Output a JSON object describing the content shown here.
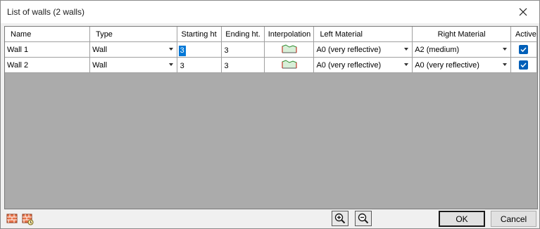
{
  "window": {
    "title": "List of walls (2 walls)"
  },
  "columns": [
    {
      "key": "name",
      "label": "Name"
    },
    {
      "key": "type",
      "label": "Type"
    },
    {
      "key": "start",
      "label": "Starting ht"
    },
    {
      "key": "end",
      "label": "Ending ht."
    },
    {
      "key": "interp",
      "label": "Interpolation"
    },
    {
      "key": "left",
      "label": "Left Material"
    },
    {
      "key": "right",
      "label": "Right Material"
    },
    {
      "key": "active",
      "label": "Active"
    }
  ],
  "rows": [
    {
      "name": "Wall 1",
      "type": "Wall",
      "start": "3",
      "end": "3",
      "left": "A0 (very reflective)",
      "right": "A2 (medium)",
      "active": true
    },
    {
      "name": "Wall 2",
      "type": "Wall",
      "start": "3",
      "end": "3",
      "left": "A0 (very reflective)",
      "right": "A0 (very reflective)",
      "active": true
    }
  ],
  "buttons": {
    "ok": "OK",
    "cancel": "Cancel"
  },
  "colors": {
    "selection": "#0078d7",
    "checkbox": "#005fb8",
    "grid_bg": "#ababab"
  },
  "icons": [
    "close-icon",
    "add-wall-icon",
    "wall-properties-icon",
    "zoom-in-icon",
    "zoom-out-icon",
    "interpolation-icon",
    "checkmark-icon",
    "dropdown-arrow-icon"
  ]
}
